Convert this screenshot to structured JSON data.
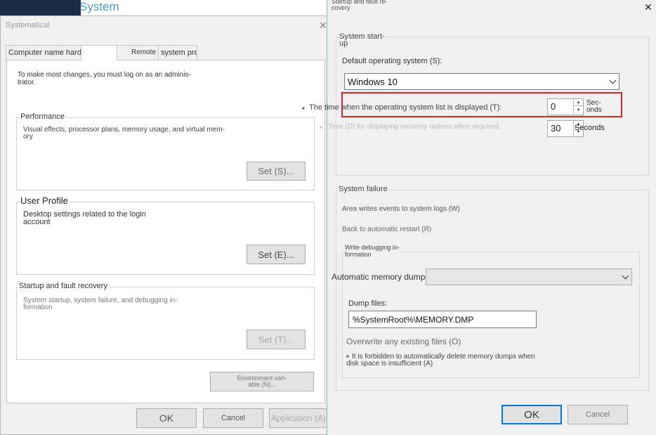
{
  "background": {
    "title": "System",
    "window_title": "Systematical",
    "close_glyph": "✕",
    "tabs": [
      {
        "label": "Computer name hardware advanced"
      },
      {
        "label": "Remote"
      },
      {
        "label": "system protection"
      }
    ],
    "admin_notice": "To make most changes, you must log on as an adminis-\ntrator.",
    "performance": {
      "title": "Performance",
      "description": "Visual effects, processor plans, memory usage, and virtual mem-\nory",
      "button": "Set (S)..."
    },
    "user_profile": {
      "title": "User Profile",
      "description": "Desktop settings related to the login\naccount",
      "button": "Set (E)..."
    },
    "startup_recovery": {
      "title": "Startup and fault recovery",
      "description": "System startup, system failure, and debugging in-\nformation",
      "button": "Set (T)..."
    },
    "env_button": "Environment vari-\nable (N)...",
    "footer": {
      "ok": "OK",
      "cancel": "Cancel",
      "apply": "Application (A)"
    }
  },
  "dialog": {
    "title": "Startup and fault re-\ncovery",
    "close_glyph": "✕",
    "system_startup": {
      "title": "System start-\nup",
      "default_os_label": "Default operating system (S):",
      "default_os_value": "Windows 10",
      "os_list_label": "The time when the operating system list is displayed (T):",
      "os_list_value": "0",
      "os_list_unit": "Sec-\nonds",
      "recovery_label": "Time (D) for displaying recovery options when required:",
      "recovery_value": "30",
      "recovery_unit": "Seconds"
    },
    "system_failure": {
      "title": "System failure",
      "write_events": "Area writes events to system logs (W)",
      "auto_restart": "Back to automatic restart (R)",
      "debug_info": {
        "title": "Write debugging in-\nformation",
        "dump_type": "Automatic memory dump",
        "dump_file_label": "Dump files:",
        "dump_file_value": "%SystemRoot%\\MEMORY.DMP",
        "overwrite": "Overwrite any existing files (O)",
        "low_disk": "It is forbidden to automatically delete memory dumps when\ndisk space is insufficient (A)"
      }
    },
    "footer": {
      "ok": "OK",
      "cancel": "Cancel"
    }
  },
  "colors": {
    "highlight": "#d82626",
    "accent": "#0078d7",
    "title_blue": "#4a98d6"
  }
}
